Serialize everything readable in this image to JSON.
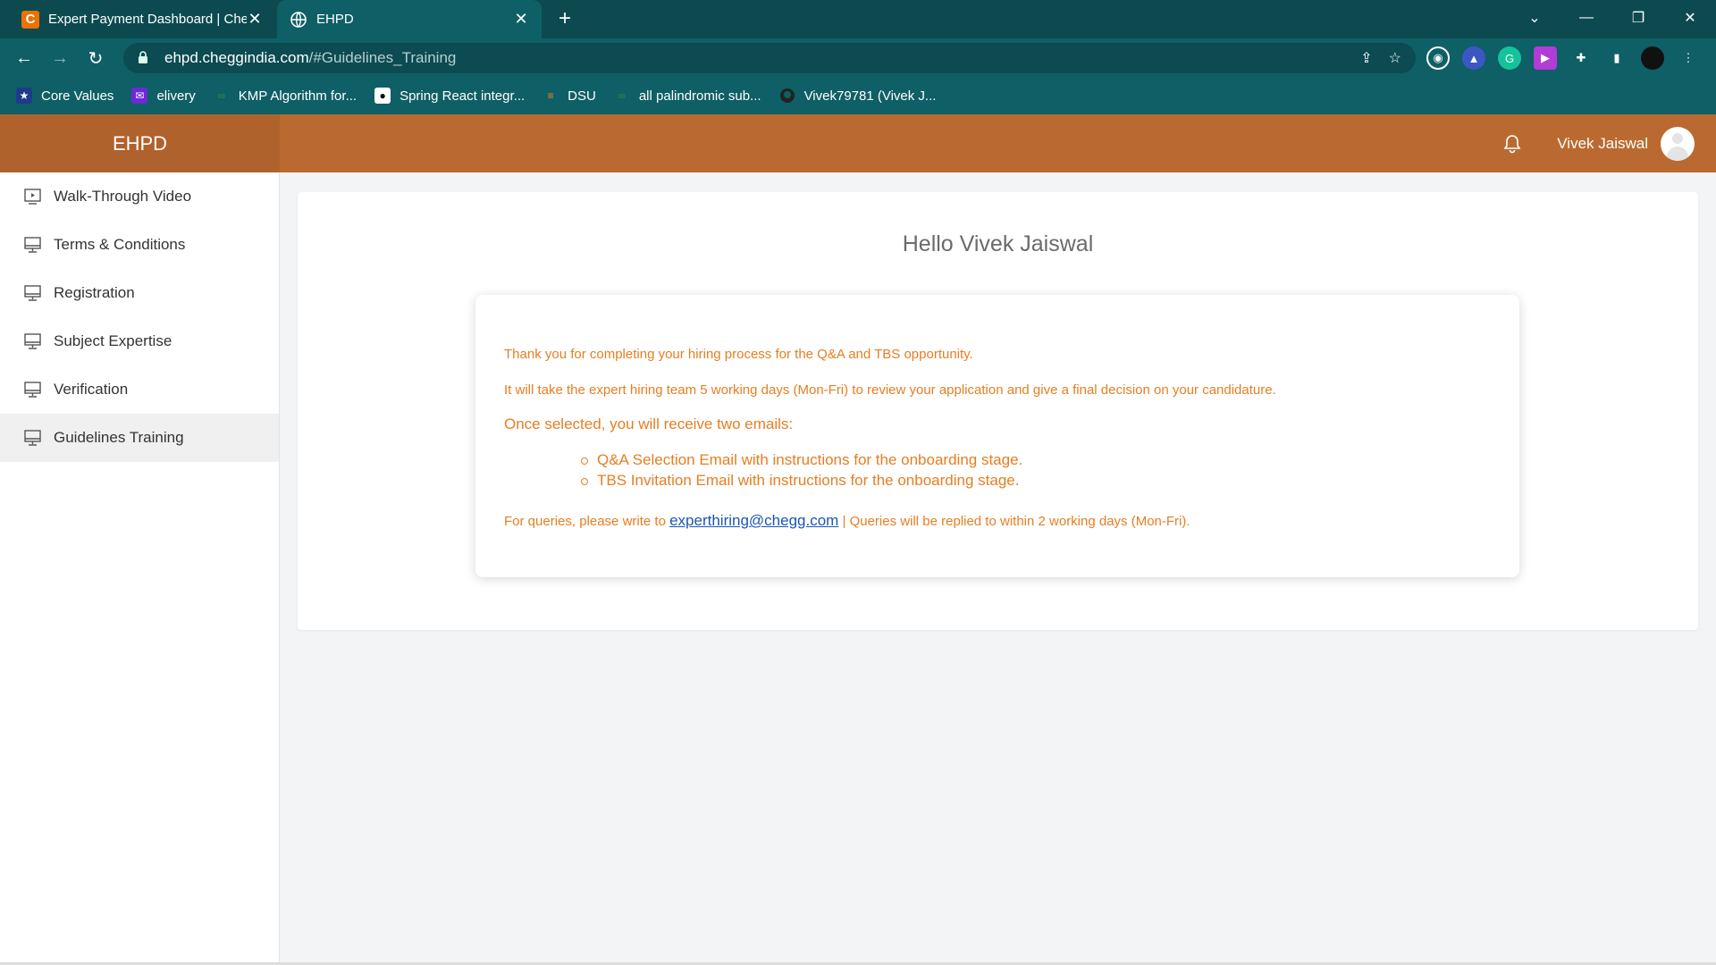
{
  "browser": {
    "tabs": [
      {
        "title": "Expert Payment Dashboard | Che",
        "active": false,
        "favicon": "C"
      },
      {
        "title": "EHPD",
        "active": true,
        "favicon": "globe-icon"
      }
    ],
    "new_tab_label": "+",
    "url_domain": "ehpd.cheggindia.com",
    "url_path": "/#Guidelines_Training",
    "bookmarks": [
      {
        "label": "Core Values",
        "icon": "star-icon"
      },
      {
        "label": "elivery",
        "icon": "envelope-icon"
      },
      {
        "label": "KMP Algorithm for...",
        "icon": "gfg-icon"
      },
      {
        "label": "Spring React integr...",
        "icon": "medium-icon"
      },
      {
        "label": "DSU",
        "icon": "stack-icon"
      },
      {
        "label": "all palindromic sub...",
        "icon": "gfg-icon"
      },
      {
        "label": "Vivek79781 (Vivek J...",
        "icon": "github-icon"
      }
    ]
  },
  "app": {
    "brand": "EHPD",
    "user_name": "Vivek Jaiswal",
    "sidebar": {
      "items": [
        {
          "label": "Walk-Through Video",
          "icon": "video-icon",
          "active": false
        },
        {
          "label": "Terms & Conditions",
          "icon": "monitor-icon",
          "active": false
        },
        {
          "label": "Registration",
          "icon": "monitor-icon",
          "active": false
        },
        {
          "label": "Subject Expertise",
          "icon": "monitor-icon",
          "active": false
        },
        {
          "label": "Verification",
          "icon": "monitor-icon",
          "active": false
        },
        {
          "label": "Guidelines Training",
          "icon": "monitor-icon",
          "active": true
        }
      ]
    },
    "main": {
      "greeting": "Hello Vivek Jaiswal",
      "line1": "Thank you for completing your hiring process for the Q&A and TBS opportunity.",
      "line2": "It will take the expert hiring team 5 working days (Mon-Fri) to review your application and give a final decision on your candidature.",
      "selected_heading": "Once selected, you will receive two emails:",
      "emails": [
        "Q&A Selection Email with instructions for the onboarding stage.",
        "TBS Invitation Email with instructions for the onboarding stage."
      ],
      "query_prefix": "For queries, please write to ",
      "query_email": "experthiring@chegg.com",
      "query_suffix": " | Queries will be replied to within 2 working days (Mon-Fri)."
    },
    "colors": {
      "header": "#ba6a30",
      "accent_text": "#e67e22",
      "link": "#1a56b4",
      "chrome": "#0f5f66"
    }
  }
}
